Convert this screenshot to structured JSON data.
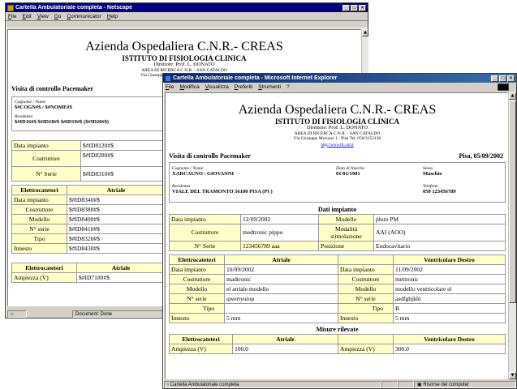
{
  "netscape": {
    "title": "Cartella Ambulatoriale completa - Netscape",
    "menu": [
      "File",
      "Edit",
      "View",
      "Go",
      "Communicator",
      "Help"
    ],
    "header": {
      "org": "Azienda Ospedaliera C.N.R.- CREAS",
      "institute": "ISTITUTO DI FISIOLOGIA CLINICA",
      "director": "Direttore: Prof. L. DONATO",
      "area": "AREA DI RICERCA C.N.R. - SAN CATALDO",
      "address": "Via Giuseppe Moruzzi 1 - Pisa Tel. 050/3152130"
    },
    "visit_title": "Visita di controllo Pacemaker",
    "patient": {
      "name_label": "Cognome / Nome",
      "name_value": "$#COGN#$ / $#NOME#$",
      "res_label": "Residenza",
      "res_value": "$#ID16#$ $#ID18#$ $#ID19#$ ($#ID20#$)"
    },
    "implant": [
      {
        "label": "Data impianto",
        "value": "$#ID8120#$"
      },
      {
        "label": "Costruttore",
        "value": "$#ID8280#$"
      },
      {
        "label": "N° Serie",
        "value": "$#ID8310#$"
      }
    ],
    "electro_head": [
      "Elettrocateteri",
      "Atriale"
    ],
    "electro": [
      {
        "label": "Data impianto",
        "value": "$#ID8340#$"
      },
      {
        "label": "Costruttore",
        "value": "$#ID8380#$"
      },
      {
        "label": "Modello",
        "value": "$#ID8400#$"
      },
      {
        "label": "N° serie",
        "value": "$#ID8410#$"
      },
      {
        "label": "Tipo",
        "value": "$#ID8320#$"
      },
      {
        "label": "Innesto",
        "value": "$#ID8430#$"
      }
    ],
    "section_m": "M",
    "electro2_head": [
      "Elettrocateteri",
      "Atriale"
    ],
    "amp": {
      "label": "Ampiezza (V)",
      "value": "$#ID7180#$"
    },
    "status": "Document: Done"
  },
  "ie": {
    "title": "Cartella Ambulatoriale completa - Microsoft Internet Explorer",
    "menu": [
      "File",
      "Modifica",
      "Visualizza",
      "Preferiti",
      "Strumenti",
      "?"
    ],
    "header": {
      "org": "Azienda Ospedaliera C.N.R.- CREAS",
      "institute": "ISTITUTO DI FISIOLOGIA CLINICA",
      "director": "Direttore: Prof. L. DONATO",
      "area": "AREA DI RICERCA C.N.R. - SAN CATALDO",
      "address": "Via Giuseppe Moruzzi 1 - Pisa Tel. 050/3152130",
      "link": "http://www.ifc.cnr.it"
    },
    "visit_title": "Visita di controllo Pacemaker",
    "visit_date": "Pisa, 05/09/2002",
    "patient": {
      "name_label": "Cognome / Nome",
      "name_value": "XARCAUNO / GIOVANNI",
      "dob_label": "Data di Nascita",
      "dob_value": "01/01/1901",
      "sex_label": "Sesso",
      "sex_value": "Maschio",
      "res_label": "Residenza",
      "res_value": "VIALE DEL TRAMONTO 56100 PISA (PI )",
      "tel_label": "Telefono",
      "tel_value": "050 123456789"
    },
    "implant_title": "Dati impianto",
    "implant": {
      "date_label": "Data impianto",
      "date_value": "12/09/2002",
      "model_label": "Modello",
      "model_value": "pluto PM",
      "maker_label": "Costruttore",
      "maker_value": "medtronic pippo",
      "mode_label": "Modalità stimolazione",
      "mode_value": "AAI (AOO)",
      "serial_label": "N° Serie",
      "serial_value": "123456789 aaa",
      "pos_label": "Posizione",
      "pos_value": "Endocavitario"
    },
    "electro_head": {
      "col1": "Elettrocateteri",
      "atrial": "Atriale",
      "ventricular": "Ventricolare Destro"
    },
    "electro": [
      {
        "label": "Data impianto",
        "atrial": "10/09/2002",
        "label2": "Data impianto",
        "ventricular": "11/09/2002"
      },
      {
        "label": "Costruttore",
        "atrial": "madtronic",
        "label2": "Costruttore",
        "ventricular": "mettronic"
      },
      {
        "label": "Modello",
        "atrial": "el atriale modello",
        "label2": "Modello",
        "ventricular": "modello ventricolare el"
      },
      {
        "label": "N° serie",
        "atrial": "qwertyuiop",
        "label2": "N° serie",
        "ventricular": "asdfghjklò"
      },
      {
        "label": "Tipo",
        "atrial": "",
        "label2": "Tipo",
        "ventricular": "B"
      },
      {
        "label": "Innesto",
        "atrial": "5 mm",
        "label2": "Innesto",
        "ventricular": "5 mm"
      }
    ],
    "measures_title": "Misure rilevate",
    "measures_head": {
      "col1": "Elettrocateteri",
      "atrial": "Atriale",
      "ventricular": "Ventricolare Destro"
    },
    "measures": [
      {
        "label": "Ampiezza (V)",
        "atrial": "100.0",
        "label2": "Ampiezza (V)",
        "ventricular": "300.0"
      }
    ],
    "status": "Cartella Ambulatoriale completa",
    "status_zone": "Risorse del computer"
  },
  "colors": {
    "netscape_titlebar": "#000080",
    "ie_titlebar": "#0a246a",
    "label_fill": "#ffffc8",
    "link": "#0000ff"
  },
  "icons": [
    "netscape-logo-icon",
    "ie-logo-icon",
    "minimize-icon",
    "maximize-icon",
    "close-icon",
    "scroll-up-icon",
    "scroll-down-icon",
    "computer-icon",
    "page-icon"
  ]
}
